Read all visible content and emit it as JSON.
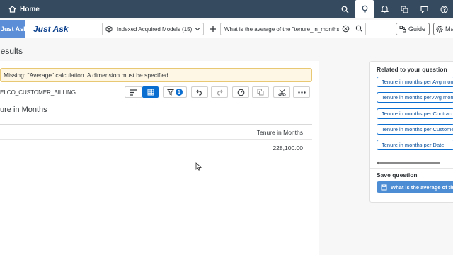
{
  "shell": {
    "home_label": "Home"
  },
  "app": {
    "tab_label": "Just Ask",
    "title": "Just Ask",
    "model_selector": "Indexed Acquired Models (15)",
    "query_value": "What is the average of the \"tenure_in_months",
    "guide_label": "Guide",
    "more_label": "Ma"
  },
  "results": {
    "heading": "Results",
    "message": "Missing: \"Average\" calculation. A dimension must be specified.",
    "dataset": "ELCO_CUSTOMER_BILLING",
    "filter_count": "1",
    "result_title": "ure in Months",
    "column_header": "Tenure in Months",
    "value": "228,100.00"
  },
  "side_panel": {
    "heading": "Related to your question",
    "suggestions": [
      "Tenure in months per Avg month",
      "Tenure in months per Avg month",
      "Tenure in months per Contract",
      "Tenure in months per Customer",
      "Tenure in months per Date"
    ],
    "save_heading": "Save question",
    "save_button": "What is the average of the"
  }
}
